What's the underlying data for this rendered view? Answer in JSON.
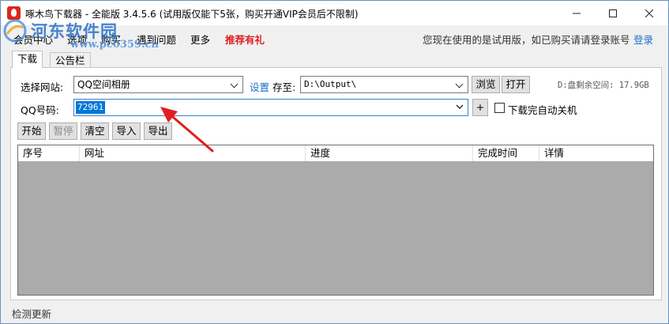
{
  "window": {
    "title": "啄木鸟下载器 - 全能版 3.4.5.6 (试用版仅能下5张，购买开通VIP会员后不限制)"
  },
  "watermark": {
    "text": "河东软件园",
    "url": "www.pc0359.cn"
  },
  "menu": {
    "items": [
      "会员中心",
      "选项",
      "购买",
      "遇到问题",
      "更多",
      "推荐有礼"
    ],
    "trial_note": "您现在使用的是试用版，如已购买请请登录账号",
    "login": "登录"
  },
  "tabs": [
    "下载",
    "公告栏"
  ],
  "form": {
    "site_label": "选择网站:",
    "site_value": "QQ空间相册",
    "settings_link": "设置",
    "save_label": "存至:",
    "save_path": "D:\\Output\\",
    "browse_button": "浏览",
    "open_button": "打开",
    "disk_space": "D:盘剩余空间: 17.9GB",
    "qq_label": "QQ号码:",
    "qq_value": "72961",
    "add_button": "+",
    "auto_shutdown_label": "下载完自动关机",
    "auto_shutdown_checked": false
  },
  "toolbar": {
    "start": "开始",
    "pause": "暂停",
    "clear": "清空",
    "import": "导入",
    "export": "导出"
  },
  "table": {
    "columns": [
      "序号",
      "网址",
      "进度",
      "完成时间",
      "详情"
    ],
    "rows": []
  },
  "status": {
    "text": "检测更新"
  },
  "colors": {
    "accent": "#1a6fcf",
    "highlight_red": "#e02020",
    "selection": "#0078d7",
    "table_bg": "#ababab"
  }
}
